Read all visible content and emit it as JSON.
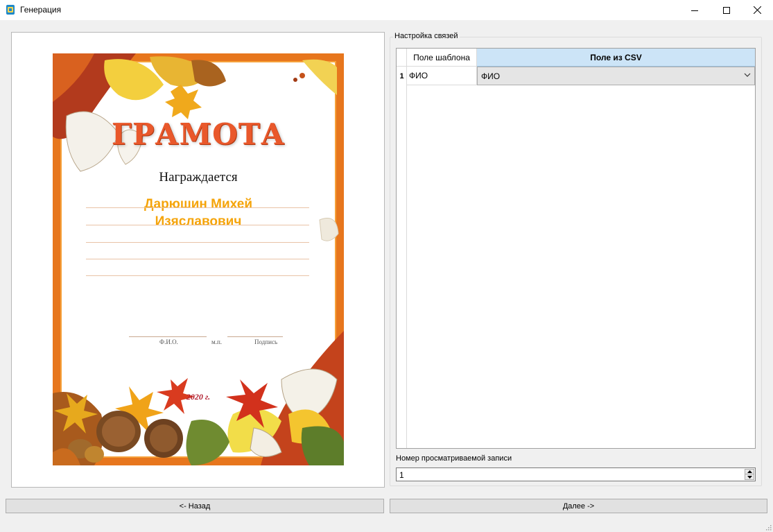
{
  "window": {
    "title": "Генерация",
    "minimize_icon": "minimize-icon",
    "maximize_icon": "maximize-icon",
    "close_icon": "close-icon"
  },
  "preview": {
    "certificate": {
      "title": "ГРАМОТА",
      "awarded": "Награждается",
      "name_line1": "Дарюшин Михей",
      "name_line2": "Изяславович",
      "sig_fio": "Ф.И.О.",
      "sig_mp": "м.п.",
      "sig_sign": "Подпись",
      "year": "2020 г."
    }
  },
  "mapping": {
    "group_title": "Настройка связей",
    "columns": [
      "Поле шаблона",
      "Поле из CSV"
    ],
    "rows": [
      {
        "number": "1",
        "template_field": "ФИО",
        "csv_field": "ФИО"
      }
    ]
  },
  "record": {
    "label": "Номер просматриваемой записи",
    "value": "1"
  },
  "buttons": {
    "back": "<- Назад",
    "next": "Далее ->"
  },
  "colors": {
    "header_selected": "#cce4f7",
    "certificate_title": "#e9582b",
    "certificate_name": "#f5a40a"
  }
}
